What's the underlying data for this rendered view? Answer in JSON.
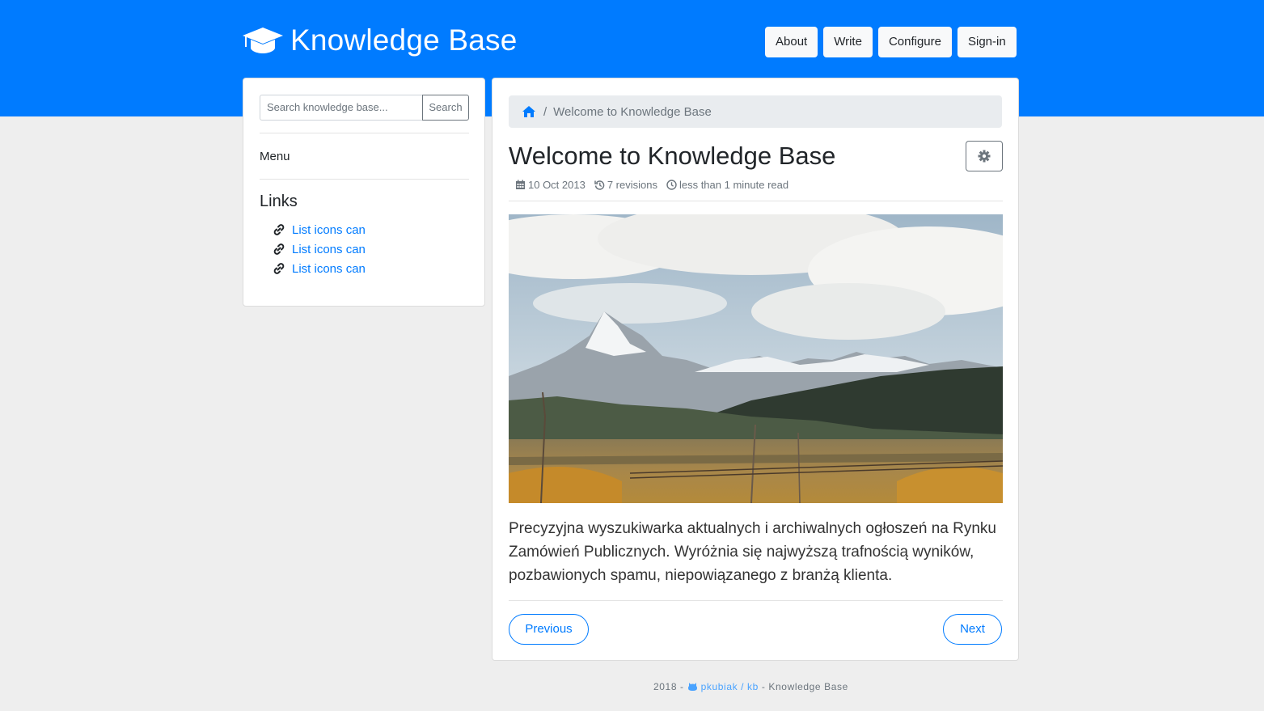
{
  "header": {
    "title": "Knowledge Base",
    "nav": [
      "About",
      "Write",
      "Configure",
      "Sign-in"
    ]
  },
  "sidebar": {
    "search": {
      "placeholder": "Search knowledge base...",
      "button": "Search"
    },
    "menu_label": "Menu",
    "links_title": "Links",
    "links": [
      "List icons can",
      "List icons can",
      "List icons can"
    ]
  },
  "main": {
    "breadcrumb": {
      "separator": "/",
      "current": "Welcome to Knowledge Base"
    },
    "title": "Welcome to Knowledge Base",
    "meta": {
      "date": "10 Oct 2013",
      "revisions": "7 revisions",
      "read_time": "less than 1 minute read"
    },
    "body": "Precyzyjna wyszukiwarka aktualnych i archiwalnych ogłoszeń na Rynku Zamówień Publicznych. Wyróżnia się najwyższą trafnością wyników, pozbawionych spamu, niepowiązanego z branżą klienta.",
    "prev_label": "Previous",
    "next_label": "Next"
  },
  "footer": {
    "year": "2018 -",
    "repo": "pkubiak / kb",
    "suffix": "- Knowledge Base"
  },
  "colors": {
    "primary": "#007bff",
    "background": "#eeeeee",
    "secondary": "#6c757d"
  }
}
